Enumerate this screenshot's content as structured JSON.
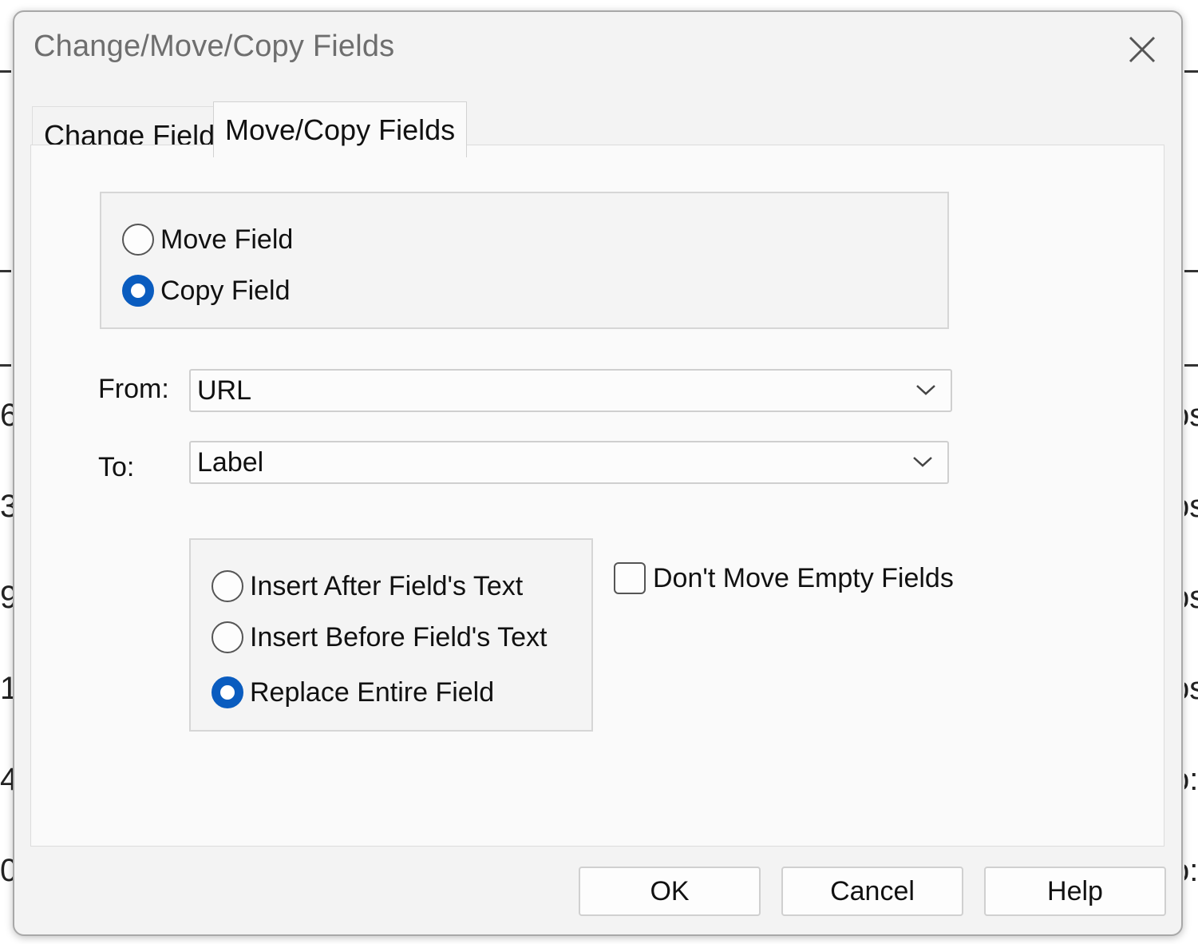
{
  "dialog": {
    "title": "Change/Move/Copy Fields",
    "close_icon": "close-icon"
  },
  "tabs": [
    {
      "label": "Change Fields",
      "selected": false
    },
    {
      "label": "Move/Copy Fields",
      "selected": true
    }
  ],
  "mode_options": [
    {
      "label": "Move Field",
      "selected": false
    },
    {
      "label": "Copy Field",
      "selected": true
    }
  ],
  "from": {
    "label": "From:",
    "value": "URL"
  },
  "to": {
    "label": "To:",
    "value": "Label"
  },
  "insert_options": [
    {
      "label": "Insert After Field's Text",
      "selected": false
    },
    {
      "label": "Insert Before Field's Text",
      "selected": false
    },
    {
      "label": "Replace Entire Field",
      "selected": true
    }
  ],
  "dont_move_empty": {
    "label": "Don't Move Empty Fields",
    "checked": false
  },
  "buttons": {
    "ok": "OK",
    "cancel": "Cancel",
    "help": "Help"
  },
  "background_fragments": [
    "6",
    "3",
    "9",
    "1",
    "4",
    "0",
    "os",
    "os",
    "os",
    "os",
    "o:",
    "o:"
  ],
  "colors": {
    "accent": "#0a5cbf",
    "dialog_bg": "#f3f3f3",
    "panel_bg": "#fafafa"
  }
}
